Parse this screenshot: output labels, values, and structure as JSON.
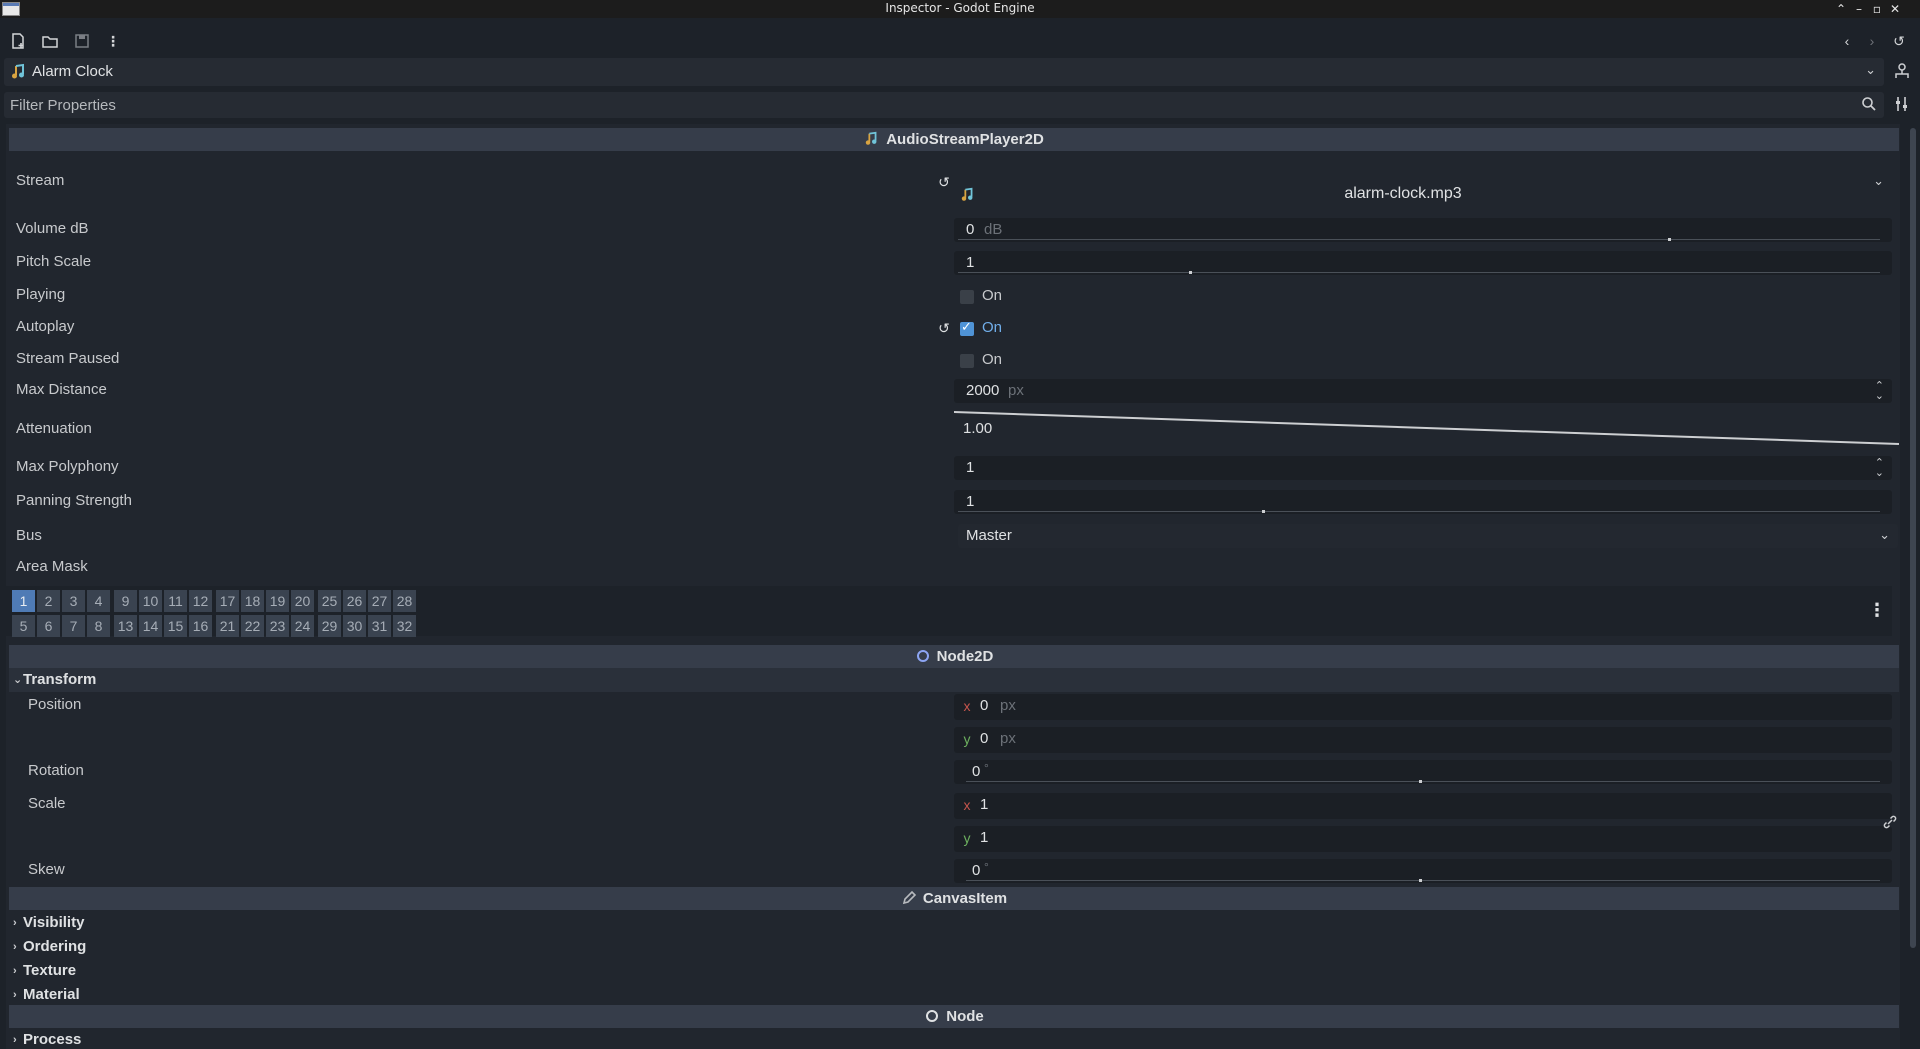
{
  "window": {
    "title": "Inspector - Godot Engine"
  },
  "toolbar": {
    "icons": [
      "new-resource-icon",
      "open-folder-icon",
      "save-icon",
      "more-vertical-icon"
    ]
  },
  "object": {
    "name": "Alarm Clock"
  },
  "filter": {
    "placeholder": "Filter Properties"
  },
  "sections": {
    "audio": {
      "title": "AudioStreamPlayer2D"
    },
    "node2d": {
      "title": "Node2D"
    },
    "canvasitem": {
      "title": "CanvasItem"
    },
    "node": {
      "title": "Node"
    }
  },
  "properties": {
    "stream": {
      "label": "Stream",
      "file": "alarm-clock.mp3"
    },
    "volume_db": {
      "label": "Volume dB",
      "value": "0",
      "unit": "dB",
      "level": 0.77
    },
    "pitch_scale": {
      "label": "Pitch Scale",
      "value": "1",
      "level": 0.25
    },
    "playing": {
      "label": "Playing",
      "text": "On",
      "checked": false
    },
    "autoplay": {
      "label": "Autoplay",
      "text": "On",
      "checked": true
    },
    "stream_paused": {
      "label": "Stream Paused",
      "text": "On",
      "checked": false
    },
    "max_distance": {
      "label": "Max Distance",
      "value": "2000",
      "unit": "px"
    },
    "attenuation": {
      "label": "Attenuation",
      "value": "1.00"
    },
    "max_polyphony": {
      "label": "Max Polyphony",
      "value": "1"
    },
    "panning_strength": {
      "label": "Panning Strength",
      "value": "1",
      "level": 0.33
    },
    "bus": {
      "label": "Bus",
      "value": "Master"
    },
    "area_mask": {
      "label": "Area Mask",
      "enabled_layers": [
        1
      ]
    }
  },
  "transform": {
    "title": "Transform",
    "position": {
      "label": "Position",
      "x": "0",
      "y": "0",
      "unit": "px",
      "x_axis": "x",
      "y_axis": "y"
    },
    "rotation": {
      "label": "Rotation",
      "value": "0",
      "unit": "°",
      "level": 0.5
    },
    "scale": {
      "label": "Scale",
      "x": "1",
      "y": "1",
      "x_axis": "x",
      "y_axis": "y"
    },
    "skew": {
      "label": "Skew",
      "value": "0",
      "unit": "°",
      "level": 0.5
    }
  },
  "canvas_groups": [
    "Visibility",
    "Ordering",
    "Texture",
    "Material"
  ],
  "node_groups": [
    "Process"
  ],
  "mask_bits": {
    "top": [
      "1",
      "2",
      "3",
      "4",
      "9",
      "10",
      "11",
      "12",
      "17",
      "18",
      "19",
      "20",
      "25",
      "26",
      "27",
      "28"
    ],
    "bottom": [
      "5",
      "6",
      "7",
      "8",
      "13",
      "14",
      "15",
      "16",
      "21",
      "22",
      "23",
      "24",
      "29",
      "30",
      "31",
      "32"
    ]
  },
  "colors": {
    "accent": "#4f93d6",
    "axis_x": "#c6554d",
    "axis_y": "#6db05f"
  }
}
